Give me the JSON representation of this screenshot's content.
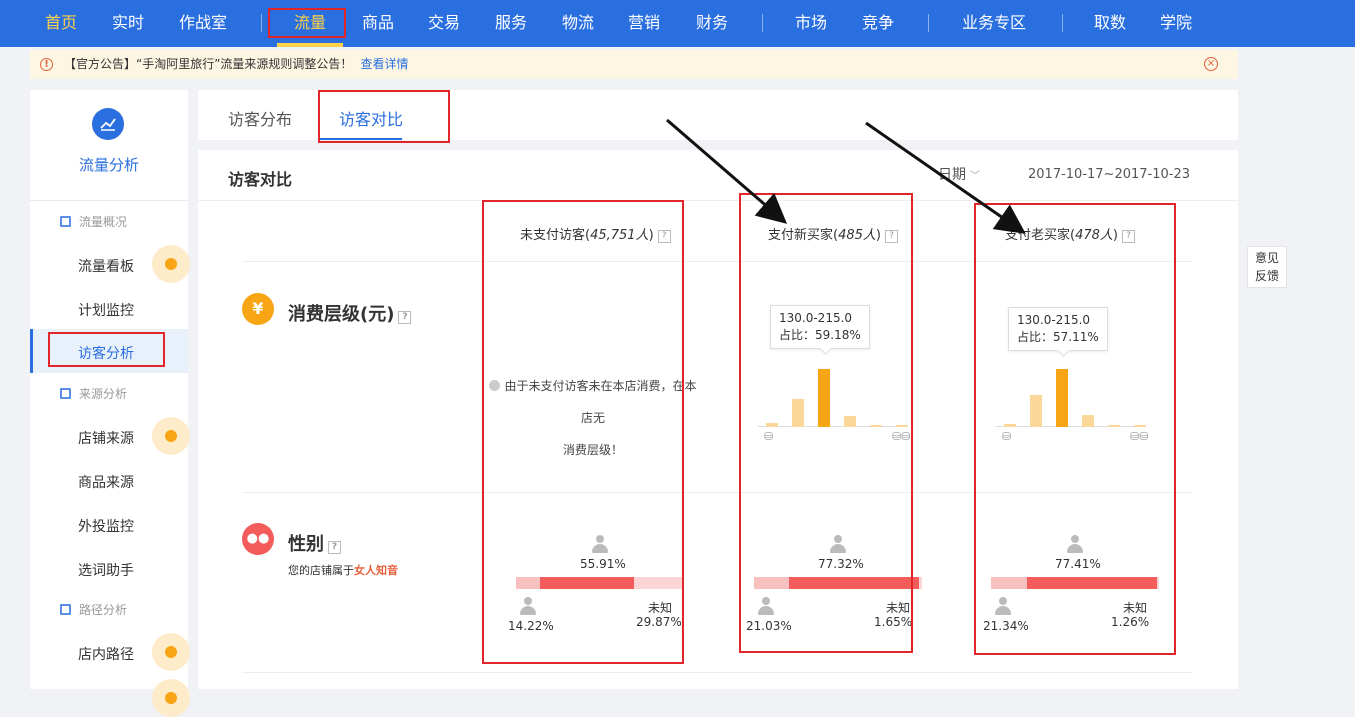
{
  "topnav": {
    "items": [
      "首页",
      "实时",
      "作战室",
      "流量",
      "商品",
      "交易",
      "服务",
      "物流",
      "营销",
      "财务",
      "市场",
      "竞争",
      "业务专区",
      "取数",
      "学院"
    ],
    "active": "流量"
  },
  "notice": {
    "text": "【官方公告】“手淘阿里旅行”流量来源规则调整公告！",
    "link": "查看详情"
  },
  "sidebar": {
    "title": "流量分析",
    "groups": [
      "流量概况",
      "来源分析",
      "路径分析"
    ],
    "items": [
      "流量看板",
      "计划监控",
      "访客分析",
      "店铺来源",
      "商品来源",
      "外投监控",
      "选词助手",
      "店内路径"
    ],
    "active": "访客分析"
  },
  "tabs": [
    "访客分布",
    "访客对比"
  ],
  "panel": {
    "title": "访客对比",
    "date_label": "日期",
    "date_range": "2017-10-17~2017-10-23"
  },
  "columns": [
    {
      "name": "未支付访客",
      "count": "45,751人"
    },
    {
      "name": "支付新买家",
      "count": "485人"
    },
    {
      "name": "支付老买家",
      "count": "478人"
    }
  ],
  "consumption": {
    "title": "消费层级(元)",
    "no_data_line1": "由于未支付访客未在本店消费，在本店无",
    "no_data_line2": "消费层级！",
    "new_buyer": {
      "range": "130.0-215.0",
      "ratio": "占比：59.18%",
      "values": [
        0.04,
        0.28,
        0.59,
        0.11,
        0.02,
        0.02
      ]
    },
    "old_buyer": {
      "range": "130.0-215.0",
      "ratio": "占比：57.11%",
      "values": [
        0.03,
        0.31,
        0.57,
        0.12,
        0.02,
        0.02
      ]
    }
  },
  "gender": {
    "title": "性别",
    "note_prefix": "您的店铺属于",
    "note_highlight": "女人知音",
    "unknown_label": "未知",
    "cols": [
      {
        "female": "55.91%",
        "male": "14.22%",
        "unknown": "29.87%",
        "female_frac": 0.5591,
        "male_frac": 0.1422,
        "unknown_frac": 0.2987
      },
      {
        "female": "77.32%",
        "male": "21.03%",
        "unknown": "1.65%",
        "female_frac": 0.7732,
        "male_frac": 0.2103,
        "unknown_frac": 0.0165
      },
      {
        "female": "77.41%",
        "male": "21.34%",
        "unknown": "1.26%",
        "female_frac": 0.7741,
        "male_frac": 0.2134,
        "unknown_frac": 0.0126
      }
    ]
  },
  "feedback": {
    "line1": "意见",
    "line2": "反馈"
  },
  "colors": {
    "brand": "#2a6fe0",
    "accent": "#ffd24a",
    "bar_main": "#f7a515",
    "bar_light": "#fcd79a",
    "female": "#f45b5b",
    "male": "#f9c0c0"
  }
}
